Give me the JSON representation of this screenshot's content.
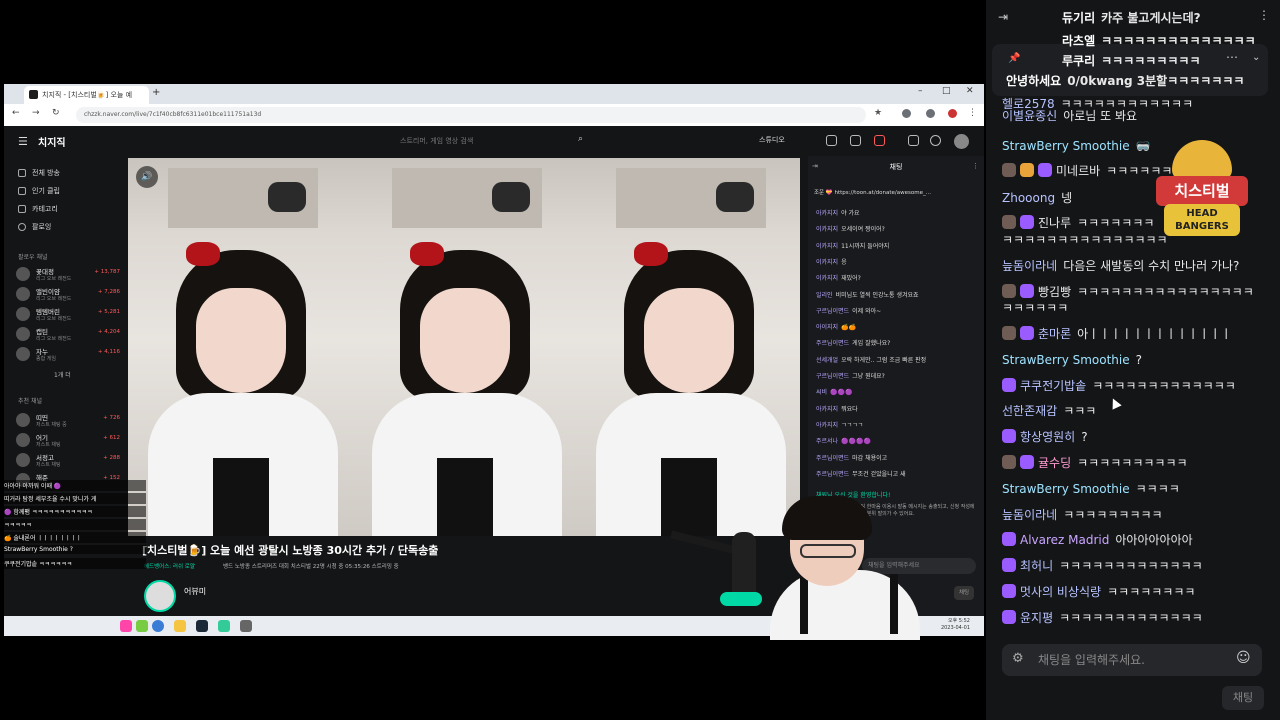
{
  "browser": {
    "tab_title": "치지직 - [치스티벌🍺] 오늘 예",
    "url": "chzzk.naver.com/live/7c1f40cb8fc6311e01bce111751a13d",
    "new_tab_symbol": "+"
  },
  "site": {
    "logo": "치지직",
    "search_placeholder": "스트리머, 게임 영상 검색",
    "studio_label": "스튜디오",
    "nav": [
      "전체 방송",
      "인기 클립",
      "카테고리",
      "팔로잉"
    ],
    "followed_section": "팔로우 채널",
    "followed": [
      {
        "name": "꽃대정",
        "sub": "리그 오브 레전드",
        "viewers": "+ 13,787"
      },
      {
        "name": "앨빈이얌",
        "sub": "리그 오브 레전드",
        "viewers": "+ 7,286"
      },
      {
        "name": "템템버린",
        "sub": "리그 오브 레전드",
        "viewers": "+ 5,281"
      },
      {
        "name": "캡틴",
        "sub": "리그 오브 레전드",
        "viewers": "+ 4,204"
      },
      {
        "name": "자누",
        "sub": "종합 게임",
        "viewers": "+ 4,116"
      }
    ],
    "more_label": "1개 더",
    "recommended_section": "추천 채널",
    "recommended": [
      {
        "name": "띠띤",
        "sub": "저스트 채팅 중",
        "viewers": "+ 726"
      },
      {
        "name": "어기",
        "sub": "저스트 채팅",
        "viewers": "+ 612"
      },
      {
        "name": "서정고",
        "sub": "저스트 채팅",
        "viewers": "+ 288"
      },
      {
        "name": "해준",
        "sub": "",
        "viewers": "+ 152"
      }
    ],
    "stream_title": "[치스티벌🍺] 오늘 예선 광탈시 노방종 30시간 추가 / 단독송출",
    "category": "헤드뱅어스: 러쉬 로얄",
    "tags": "뱅드  노방종  스트리머즈  대회  치스티벌   22명 시청 중   05:35:26 스트리밍 중",
    "streamer_name": "어뷰미",
    "streamer_sub": "치즈데이 파트너"
  },
  "inner_chat": {
    "title": "채팅",
    "pinned": "조운 💝 https://toon.at/donate/awesome_...",
    "lines": [
      {
        "n": "아카지지",
        "m": "야 가요"
      },
      {
        "n": "이카지지",
        "m": "오세이여 짱이어?"
      },
      {
        "n": "이카지지",
        "m": "11시까지 들어야지"
      },
      {
        "n": "이카지지",
        "m": "응"
      },
      {
        "n": "이카지지",
        "m": "재밌어?"
      },
      {
        "n": "일리인",
        "m": "비미님도 열씩 인강노통 생겨요죠"
      },
      {
        "n": "구르님이면드",
        "m": "이제 와아~"
      },
      {
        "n": "아이지지",
        "m": "🍊🍊"
      },
      {
        "n": "주르님이면드",
        "m": "게임 잘했나요?"
      },
      {
        "n": "선세개얼",
        "m": "오락 하게만.. 그럼 조금 빠른 판정"
      },
      {
        "n": "구르님이면드",
        "m": "그냥 뭔데요?"
      },
      {
        "n": "씨비",
        "m": "🟣🟣🟣"
      },
      {
        "n": "아카지지",
        "m": "뭐요다"
      },
      {
        "n": "아카지지",
        "m": "ㄱㄱㄱㄱ"
      },
      {
        "n": "주르서나",
        "m": "🟣🟣🟣🟣"
      },
      {
        "n": "주르님이면드",
        "m": "마감 채용이고"
      },
      {
        "n": "주르님이면드",
        "m": "무조건 걷았을니고 새"
      }
    ],
    "green_line": "채원님 오신 것을 환영합니다!",
    "notice": "채팅 한마음 이용시 발동 메시지는 송출되고, 신청 작성에 채팅 분위 발의가 수 있어요.",
    "input_placeholder": "채팅을 입력해주세요",
    "send_label": "채팅"
  },
  "overlay": [
    "아아아 아까워 이때 🟣",
    "띠거라 탐정 세부조율 수시 맞니가 게",
    "🟣 함께팸 ㅋㅋㅋㅋㅋㅋㅋㅋㅋㅋㅋ",
    "ㅋㅋㅋㅋㅋ",
    "🍊 술내론어 ㅣㅣㅣㅣㅣㅣㅣㅣ",
    "StrawBerry Smoothie ?",
    "쿠쿠전기밥솥 ㅋㅋㅋㅋㅋㅋ"
  ],
  "taskbar": {
    "time": "오후 5:52",
    "date": "2023-04-01"
  },
  "chat": {
    "rows": [
      {
        "nick": "듀기리",
        "msg": "카주 불고게시는데?",
        "color": "#ffffff",
        "badges": 0,
        "bold": true
      },
      {
        "nick": "라츠엘",
        "msg": "ㅋㅋㅋㅋㅋㅋㅋㅋㅋㅋㅋㅋㅋㅋ",
        "color": "#ffffff",
        "badges": 0,
        "bold": true
      },
      {
        "nick": "루쿠리",
        "msg": "ㅋㅋㅋㅋㅋㅋㅋㅋㅋ",
        "color": "#ffffff",
        "badges": 0,
        "bold": true
      },
      {
        "nick": "안녕하세요",
        "msg": "0/0kwang 3분할ㅋㅋㅋㅋㅋㅋㅋ",
        "color": "#ffffff",
        "badges": 0,
        "bold": true
      },
      {
        "nick": "헬로2578",
        "msg": "ㅋㅋㅋㅋㅋㅋㅋㅋㅋㅋㅋㅋ",
        "color": "#b7c3ff",
        "badges": 0,
        "bold": false
      },
      {
        "nick": "이별윤종신",
        "msg": "아로님 또 봐요",
        "color": "#b7c3ff",
        "badges": 0,
        "bold": false
      },
      {
        "nick": "StrawBerry Smoothie",
        "msg": "🥽",
        "color": "#9fe3ff",
        "badges": 0,
        "bold": false
      },
      {
        "nick": "미네르바",
        "msg": "ㅋㅋㅋㅋㅋㅋ",
        "color": "#e8e8e8",
        "badges": 3,
        "bold": false
      },
      {
        "nick": "Zhooong",
        "msg": "넹",
        "color": "#b7c3ff",
        "badges": 0,
        "bold": false
      },
      {
        "nick": "진나루",
        "msg": "ㅋㅋㅋㅋㅋㅋㅋ",
        "color": "#e8e8e8",
        "badges": 2,
        "bold": false
      },
      {
        "nick": "",
        "msg": "ㅋㅋㅋㅋㅋㅋㅋㅋㅋㅋㅋㅋㅋㅋㅋ",
        "color": "#e8e8e8",
        "badges": 0,
        "bold": false
      },
      {
        "nick": "늪돔이라네",
        "msg": "다음은 새발동의 수치 만나러 가나?",
        "color": "#b7c3ff",
        "badges": 0,
        "bold": false
      },
      {
        "nick": "빵김빵",
        "msg": "ㅋㅋㅋㅋㅋㅋㅋㅋㅋㅋㅋㅋㅋㅋㅋㅋ",
        "color": "#e8e8e8",
        "badges": 2,
        "bold": false
      },
      {
        "nick": "",
        "msg": "ㅋㅋㅋㅋㅋㅋ",
        "color": "#e8e8e8",
        "badges": 0,
        "bold": false
      },
      {
        "nick": "춘마론",
        "msg": "아ㅣㅣㅣㅣㅣㅣㅣㅣㅣㅣㅣㅣㅣ",
        "color": "#b7c3ff",
        "badges": 2,
        "bold": false
      },
      {
        "nick": "StrawBerry Smoothie",
        "msg": "?",
        "color": "#9fe3ff",
        "badges": 0,
        "bold": false
      },
      {
        "nick": "쿠쿠전기밥솥",
        "msg": "ㅋㅋㅋㅋㅋㅋㅋㅋㅋㅋㅋㅋㅋ",
        "color": "#b7c3ff",
        "badges": 1,
        "bold": false
      },
      {
        "nick": "선한존재감",
        "msg": "ㅋㅋㅋ",
        "color": "#b7c3ff",
        "badges": 0,
        "bold": false
      },
      {
        "nick": "항상영원히",
        "msg": "?",
        "color": "#b7c3ff",
        "badges": 1,
        "bold": false
      },
      {
        "nick": "귤수딩",
        "msg": "ㅋㅋㅋㅋㅋㅋㅋㅋㅋㅋ",
        "color": "#ff9bd2",
        "badges": 2,
        "bold": false
      },
      {
        "nick": "StrawBerry Smoothie",
        "msg": "ㅋㅋㅋㅋ",
        "color": "#9fe3ff",
        "badges": 0,
        "bold": false
      },
      {
        "nick": "늪돔이라네",
        "msg": "ㅋㅋㅋㅋㅋㅋㅋㅋㅋ",
        "color": "#b7c3ff",
        "badges": 0,
        "bold": false
      },
      {
        "nick": "Alvarez Madrid",
        "msg": "아아아아아아아",
        "color": "#c9a6ff",
        "badges": 1,
        "bold": false
      },
      {
        "nick": "최허니",
        "msg": "ㅋㅋㅋㅋㅋㅋㅋㅋㅋㅋㅋㅋㅋ",
        "color": "#b7c3ff",
        "badges": 1,
        "bold": false
      },
      {
        "nick": "멋사의 비상식량",
        "msg": "ㅋㅋㅋㅋㅋㅋㅋㅋ",
        "color": "#b7c3ff",
        "badges": 1,
        "bold": false
      },
      {
        "nick": "윤지평",
        "msg": "ㅋㅋㅋㅋㅋㅋㅋㅋㅋㅋㅋㅋㅋ",
        "color": "#b7c3ff",
        "badges": 1,
        "bold": false
      }
    ],
    "logo_top": "치지직",
    "logo_mid": "치스티벌",
    "logo_bot_1": "HEAD",
    "logo_bot_2": "BANGERS",
    "input_placeholder": "채팅을 입력해주세요.",
    "send_label": "채팅"
  }
}
